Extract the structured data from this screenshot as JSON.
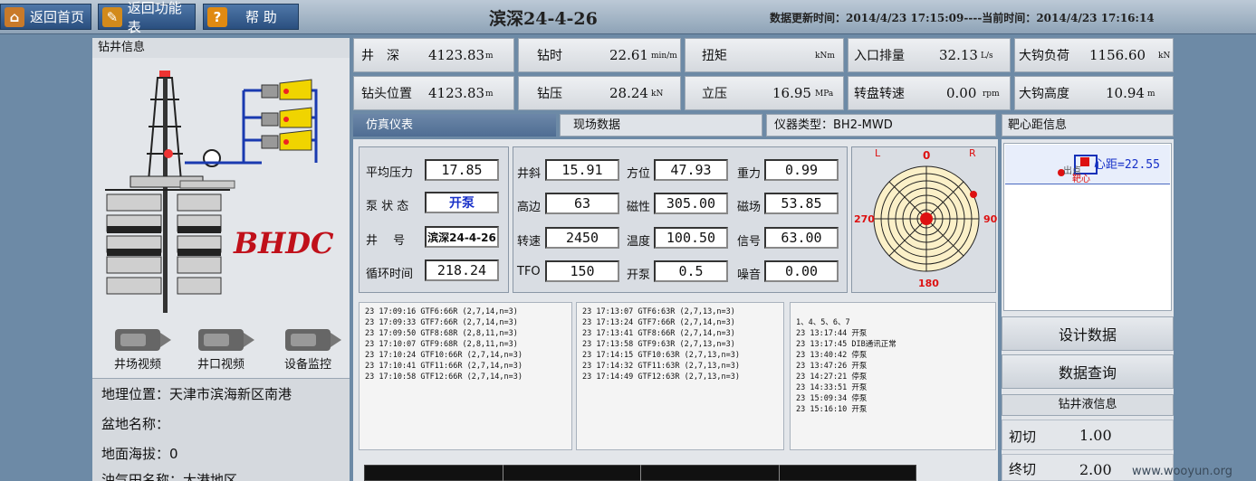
{
  "topbar": {
    "home_label": "返回首页",
    "func_label": "返回功能表",
    "help_label": "帮 助",
    "well_title": "滨深24-4-26",
    "update_label": "数据更新时间：",
    "update_time": "2014/4/23 17:15:09",
    "separator": "----",
    "current_label": "当前时间：",
    "current_time": "2014/4/23 17:16:14"
  },
  "left": {
    "panel_title": "钻井信息",
    "logo": "BHDC",
    "video_buttons": [
      "井场视频",
      "井口视频",
      "设备监控"
    ],
    "info": {
      "location_label": "地理位置：",
      "location_value": "天津市滨海新区南港",
      "basin_label": "盆地名称：",
      "basin_value": "",
      "elevation_label": "地面海拔：",
      "elevation_value": "0",
      "field_label": "油气田名称：",
      "field_value": "大港地区"
    }
  },
  "metrics": [
    {
      "label": "井　深",
      "value": "4123.83",
      "unit": "m"
    },
    {
      "label": "钻时",
      "value": "22.61",
      "unit": "min/m"
    },
    {
      "label": "扭矩",
      "value": "",
      "unit": "kNm"
    },
    {
      "label": "入口排量",
      "value": "32.13",
      "unit": "L/s"
    },
    {
      "label": "大钩负荷",
      "value": "1156.60",
      "unit": "kN"
    },
    {
      "label": "钻头位置",
      "value": "4123.83",
      "unit": "m"
    },
    {
      "label": "钻压",
      "value": "28.24",
      "unit": "kN"
    },
    {
      "label": "立压",
      "value": "16.95",
      "unit": "MPa"
    },
    {
      "label": "转盘转速",
      "value": "0.00",
      "unit": "rpm"
    },
    {
      "label": "大钩高度",
      "value": "10.94",
      "unit": "m"
    }
  ],
  "tabs": {
    "sim": "仿真仪表",
    "field": "现场数据",
    "instrument_label": "仪器类型：",
    "instrument_value": "BH2-MWD",
    "target_title": "靶心距信息"
  },
  "gauges": {
    "avg_pressure": {
      "label": "平均压力",
      "value": "17.85"
    },
    "pump_status": {
      "label": "泵 状 态",
      "value": "开泵"
    },
    "well_no": {
      "label": "井　 号",
      "value": "滨深24-4-26"
    },
    "cycle_time": {
      "label": "循环时间",
      "value": "218.24"
    },
    "inclination": {
      "label": "井斜",
      "value": "15.91"
    },
    "azimuth": {
      "label": "方位",
      "value": "47.93"
    },
    "gravity": {
      "label": "重力",
      "value": "0.99"
    },
    "highside": {
      "label": "高边",
      "value": "63"
    },
    "magnetic": {
      "label": "磁性",
      "value": "305.00"
    },
    "magfield": {
      "label": "磁场",
      "value": "53.85"
    },
    "speed": {
      "label": "转速",
      "value": "2450"
    },
    "temperature": {
      "label": "温度",
      "value": "100.50"
    },
    "signal": {
      "label": "信号",
      "value": "63.00"
    },
    "tfo": {
      "label": "TFO",
      "value": "150"
    },
    "pump_on": {
      "label": "开泵",
      "value": "0.5"
    },
    "noise": {
      "label": "噪音",
      "value": "0.00"
    }
  },
  "compass": {
    "L": "L",
    "top": "0",
    "R": "R",
    "left": "270",
    "right": "90",
    "bottom": "180"
  },
  "target": {
    "text": "心距=22.55",
    "sub": "出点",
    "sub2": "靶心"
  },
  "logs": {
    "log1": "23 17:09:16 GTF6:66R (2,7,14,n=3)\n23 17:09:33 GTF7:66R (2,7,14,n=3)\n23 17:09:50 GTF8:68R (2,8,11,n=3)\n23 17:10:07 GTF9:68R (2,8,11,n=3)\n23 17:10:24 GTF10:66R (2,7,14,n=3)\n23 17:10:41 GTF11:66R (2,7,14,n=3)\n23 17:10:58 GTF12:66R (2,7,14,n=3)",
    "log2": "23 17:13:07 GTF6:63R (2,7,13,n=3)\n23 17:13:24 GTF7:66R (2,7,14,n=3)\n23 17:13:41 GTF8:66R (2,7,14,n=3)\n23 17:13:58 GTF9:63R (2,7,13,n=3)\n23 17:14:15 GTF10:63R (2,7,13,n=3)\n23 17:14:32 GTF11:63R (2,7,13,n=3)\n23 17:14:49 GTF12:63R (2,7,13,n=3)",
    "log3": "\n1、4、5、6、7\n23 13:17:44 开泵\n23 13:17:45 DIB通讯正常\n23 13:40:42 停泵\n23 13:47:26 开泵\n23 14:27:21 停泵\n23 14:33:51 开泵\n23 15:09:34 停泵\n23 15:16:10 开泵"
  },
  "right": {
    "design_data": "设计数据",
    "data_query": "数据查询",
    "fluid_title": "钻井液信息",
    "initial_cut_label": "初切",
    "initial_cut_value": "1.00",
    "final_cut_label": "终切",
    "final_cut_value": "2.00"
  },
  "watermark": "www.wooyun.org"
}
